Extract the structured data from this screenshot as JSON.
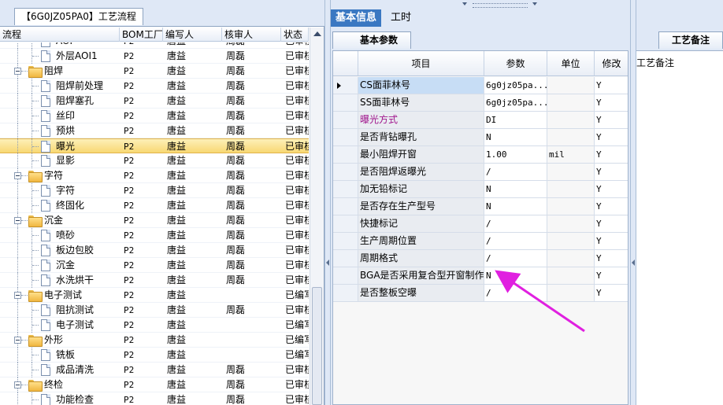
{
  "left": {
    "tab_label": "【6G0JZ05PA0】工艺流程",
    "columns": [
      "流程",
      "BOM工厂",
      "编写人",
      "核审人",
      "状态"
    ],
    "rows": [
      {
        "level": 2,
        "type": "item",
        "name": "AOI",
        "bom": "P2",
        "writer": "唐益",
        "reviewer": "周磊",
        "status": "已审核"
      },
      {
        "level": 2,
        "type": "item",
        "name": "外层AOI1",
        "bom": "P2",
        "writer": "唐益",
        "reviewer": "周磊",
        "status": "已审核"
      },
      {
        "level": 1,
        "type": "group",
        "name": "阻焊",
        "bom": "P2",
        "writer": "唐益",
        "reviewer": "周磊",
        "status": "已审核"
      },
      {
        "level": 2,
        "type": "item",
        "name": "阻焊前处理",
        "bom": "P2",
        "writer": "唐益",
        "reviewer": "周磊",
        "status": "已审核"
      },
      {
        "level": 2,
        "type": "item",
        "name": "阻焊塞孔",
        "bom": "P2",
        "writer": "唐益",
        "reviewer": "周磊",
        "status": "已审核"
      },
      {
        "level": 2,
        "type": "item",
        "name": "丝印",
        "bom": "P2",
        "writer": "唐益",
        "reviewer": "周磊",
        "status": "已审核"
      },
      {
        "level": 2,
        "type": "item",
        "name": "预烘",
        "bom": "P2",
        "writer": "唐益",
        "reviewer": "周磊",
        "status": "已审核"
      },
      {
        "level": 2,
        "type": "item",
        "name": "曝光",
        "bom": "P2",
        "writer": "唐益",
        "reviewer": "周磊",
        "status": "已审核",
        "selected": true
      },
      {
        "level": 2,
        "type": "item",
        "name": "显影",
        "bom": "P2",
        "writer": "唐益",
        "reviewer": "周磊",
        "status": "已审核"
      },
      {
        "level": 1,
        "type": "group",
        "name": "字符",
        "bom": "P2",
        "writer": "唐益",
        "reviewer": "周磊",
        "status": "已审核"
      },
      {
        "level": 2,
        "type": "item",
        "name": "字符",
        "bom": "P2",
        "writer": "唐益",
        "reviewer": "周磊",
        "status": "已审核"
      },
      {
        "level": 2,
        "type": "item",
        "name": "终固化",
        "bom": "P2",
        "writer": "唐益",
        "reviewer": "周磊",
        "status": "已审核"
      },
      {
        "level": 1,
        "type": "group",
        "name": "沉金",
        "bom": "P2",
        "writer": "唐益",
        "reviewer": "周磊",
        "status": "已审核"
      },
      {
        "level": 2,
        "type": "item",
        "name": "喷砂",
        "bom": "P2",
        "writer": "唐益",
        "reviewer": "周磊",
        "status": "已审核"
      },
      {
        "level": 2,
        "type": "item",
        "name": "板边包胶",
        "bom": "P2",
        "writer": "唐益",
        "reviewer": "周磊",
        "status": "已审核"
      },
      {
        "level": 2,
        "type": "item",
        "name": "沉金",
        "bom": "P2",
        "writer": "唐益",
        "reviewer": "周磊",
        "status": "已审核"
      },
      {
        "level": 2,
        "type": "item",
        "name": "水洗烘干",
        "bom": "P2",
        "writer": "唐益",
        "reviewer": "周磊",
        "status": "已审核"
      },
      {
        "level": 1,
        "type": "group",
        "name": "电子测试",
        "bom": "P2",
        "writer": "唐益",
        "reviewer": "",
        "status": "已编写"
      },
      {
        "level": 2,
        "type": "item",
        "name": "阻抗测试",
        "bom": "P2",
        "writer": "唐益",
        "reviewer": "周磊",
        "status": "已审核"
      },
      {
        "level": 2,
        "type": "item",
        "name": "电子测试",
        "bom": "P2",
        "writer": "唐益",
        "reviewer": "",
        "status": "已编写"
      },
      {
        "level": 1,
        "type": "group",
        "name": "外形",
        "bom": "P2",
        "writer": "唐益",
        "reviewer": "",
        "status": "已编写"
      },
      {
        "level": 2,
        "type": "item",
        "name": "铣板",
        "bom": "P2",
        "writer": "唐益",
        "reviewer": "",
        "status": "已编写"
      },
      {
        "level": 2,
        "type": "item",
        "name": "成品清洗",
        "bom": "P2",
        "writer": "唐益",
        "reviewer": "周磊",
        "status": "已审核"
      },
      {
        "level": 1,
        "type": "group",
        "name": "终检",
        "bom": "P2",
        "writer": "唐益",
        "reviewer": "周磊",
        "status": "已审核"
      },
      {
        "level": 2,
        "type": "item",
        "name": "功能检查",
        "bom": "P2",
        "writer": "唐益",
        "reviewer": "周磊",
        "status": "已审核"
      }
    ]
  },
  "middle": {
    "tabs": [
      {
        "label": "基本信息",
        "active": true
      },
      {
        "label": "工时",
        "active": false
      }
    ],
    "sub_tab": "基本参数",
    "columns": [
      "项目",
      "参数",
      "单位",
      "修改"
    ],
    "rows": [
      {
        "item": "CS面菲林号",
        "param": "6g0jz05pa...",
        "unit": "",
        "mod": "Y",
        "current": true
      },
      {
        "item": "SS面菲林号",
        "param": "6g0jz05pa...",
        "unit": "",
        "mod": "Y"
      },
      {
        "item": "曝光方式",
        "param": "DI",
        "unit": "",
        "mod": "Y",
        "color": "#a0148c"
      },
      {
        "item": "是否背钻曝孔",
        "param": "N",
        "unit": "",
        "mod": "Y"
      },
      {
        "item": "最小阻焊开窗",
        "param": "1.00",
        "unit": "mil",
        "mod": "Y"
      },
      {
        "item": "是否阻焊返曝光",
        "param": "/",
        "unit": "",
        "mod": "Y"
      },
      {
        "item": "加无铅标记",
        "param": "N",
        "unit": "",
        "mod": "Y"
      },
      {
        "item": "是否存在生产型号",
        "param": "N",
        "unit": "",
        "mod": "Y"
      },
      {
        "item": "快捷标记",
        "param": "/",
        "unit": "",
        "mod": "Y"
      },
      {
        "item": "生产周期位置",
        "param": "/",
        "unit": "",
        "mod": "Y"
      },
      {
        "item": "周期格式",
        "param": "/",
        "unit": "",
        "mod": "Y"
      },
      {
        "item": "BGA是否采用复合型开窗制作",
        "param": "N",
        "unit": "",
        "mod": "Y"
      },
      {
        "item": "是否整板空曝",
        "param": "/",
        "unit": "",
        "mod": "Y"
      }
    ]
  },
  "right": {
    "tab_label": "工艺备注",
    "content_label": "工艺备注"
  },
  "colors": {
    "accent": "#3a78c2",
    "annotation_arrow": "#e020e0",
    "selection": "#f8d873"
  }
}
